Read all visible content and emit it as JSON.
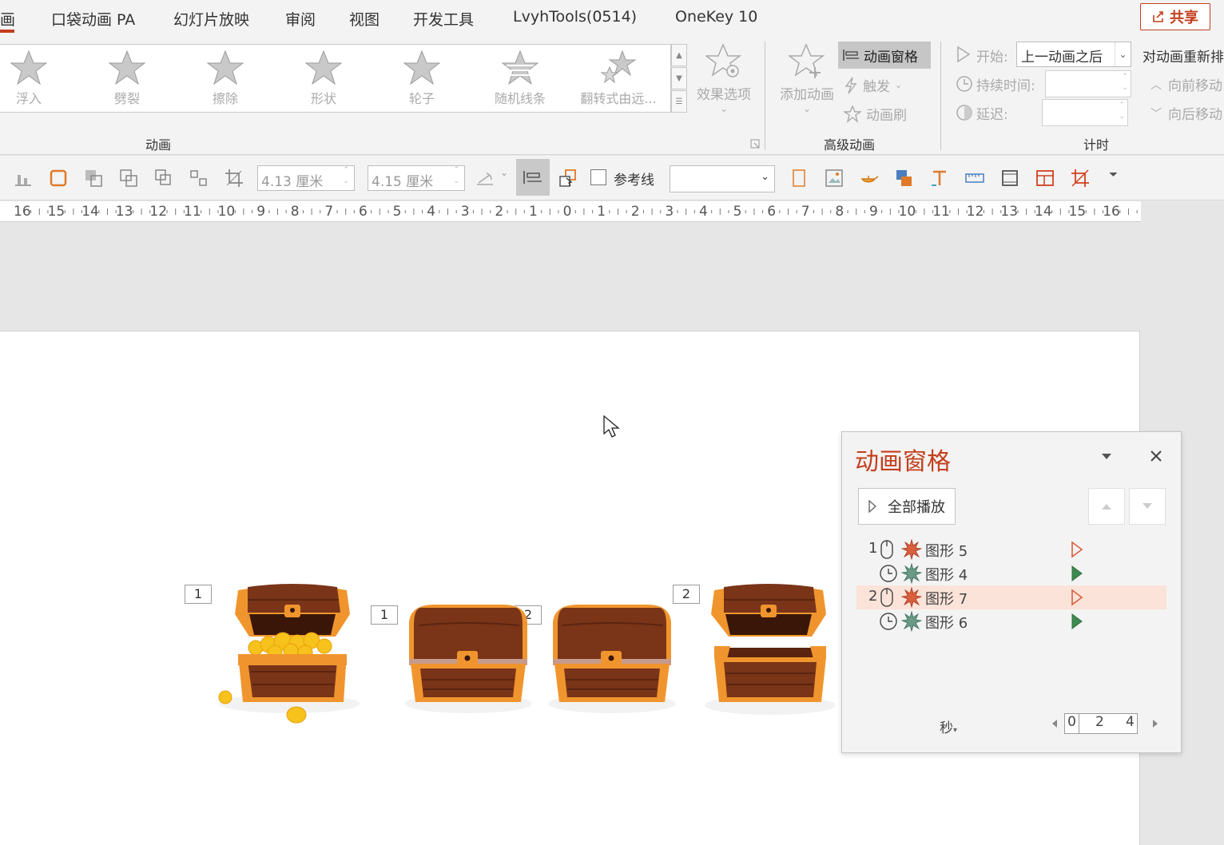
{
  "tabs": {
    "active_fragment": "画",
    "items": [
      "口袋动画 PA",
      "幻灯片放映",
      "审阅",
      "视图",
      "开发工具",
      "LvyhTools(0514)",
      "OneKey 10"
    ],
    "share": "共享"
  },
  "ribbon": {
    "gallery": [
      "浮入",
      "劈裂",
      "擦除",
      "形状",
      "轮子",
      "随机线条",
      "翻转式由远..."
    ],
    "effect_options": "效果选项",
    "group_animation": "动画",
    "add_animation": "添加动画",
    "animation_pane": "动画窗格",
    "trigger": "触发",
    "animation_painter": "动画刷",
    "group_advanced": "高级动画",
    "start_label": "开始:",
    "start_value": "上一动画之后",
    "duration_label": "持续时间:",
    "delay_label": "延迟:",
    "group_timing": "计时",
    "reorder_label": "对动画重新排",
    "move_earlier": "向前移动",
    "move_later": "向后移动"
  },
  "toolbar2": {
    "width": "4.13 厘米",
    "height": "4.15 厘米",
    "guides_label": "参考线"
  },
  "ruler": {
    "labels": [
      "16",
      "15",
      "14",
      "13",
      "12",
      "11",
      "10",
      "9",
      "8",
      "7",
      "6",
      "5",
      "4",
      "3",
      "2",
      "1",
      "0",
      "1",
      "2",
      "3",
      "4",
      "5",
      "6",
      "7",
      "8",
      "9",
      "10",
      "11",
      "12",
      "13",
      "14",
      "15",
      "16"
    ]
  },
  "slide": {
    "tags": [
      "1",
      "1",
      "2",
      "2"
    ]
  },
  "anim_pane": {
    "title": "动画窗格",
    "play_all": "全部播放",
    "rows": [
      {
        "num": "1",
        "trigger": "mouse",
        "effect": "exit",
        "name": "图形 5",
        "bar": "hollow"
      },
      {
        "num": "",
        "trigger": "clock",
        "effect": "entrance",
        "name": "图形 4",
        "bar": "solid"
      },
      {
        "num": "2",
        "trigger": "mouse",
        "effect": "exit",
        "name": "图形 7",
        "bar": "hollow"
      },
      {
        "num": "",
        "trigger": "clock",
        "effect": "entrance",
        "name": "图形 6",
        "bar": "solid"
      }
    ],
    "unit": "秒",
    "timeline": [
      "0",
      "2",
      "4"
    ]
  },
  "colors": {
    "accent": "#c43e1c",
    "exit_star": "#d9603f",
    "entrance_star": "#6a9a88",
    "selected_row": "#fbe3d9",
    "chest_orange": "#f0952e",
    "chest_brown": "#7a3418"
  }
}
